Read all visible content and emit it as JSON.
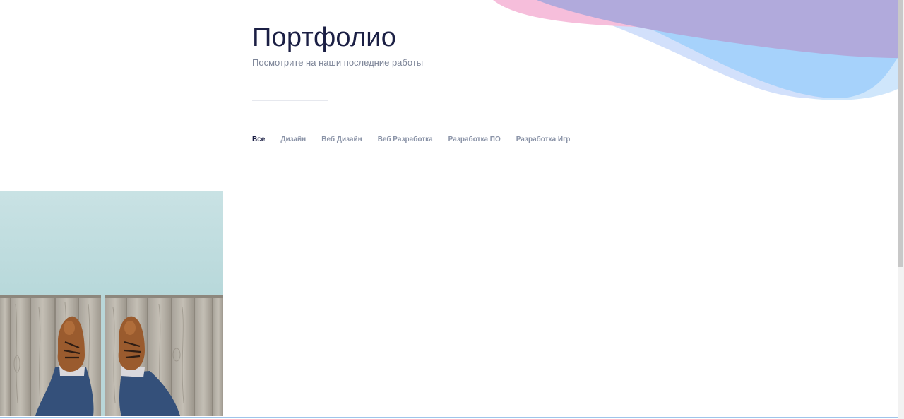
{
  "header": {
    "title": "Портфолио",
    "subtitle": "Посмотрите на наши последние работы"
  },
  "filters": {
    "items": [
      {
        "label": "Все",
        "active": true
      },
      {
        "label": "Дизайн",
        "active": false
      },
      {
        "label": "Веб Дизайн",
        "active": false
      },
      {
        "label": "Веб Разработка",
        "active": false
      },
      {
        "label": "Разработка ПО",
        "active": false
      },
      {
        "label": "Разработка Игр",
        "active": false
      }
    ]
  },
  "colors": {
    "title": "#1b1f44",
    "subtitle": "#7c8497",
    "filter_active": "#1b1f44",
    "filter_inactive": "#8a93a7",
    "wave_pink": "#f7bdd9",
    "wave_purple": "#b0aadd",
    "wave_blue": "#a9d3fb",
    "wave_light_blue": "#cfe0fb"
  },
  "icons": {
    "decoration": "gradient-waves",
    "portfolio_item": "feet-on-dock-photo"
  }
}
